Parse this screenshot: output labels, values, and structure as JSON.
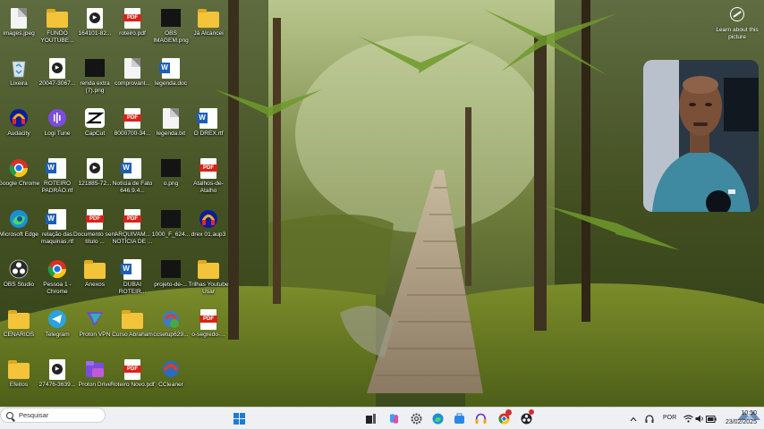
{
  "desktop": {
    "icons": [
      {
        "label": "images.jpeg",
        "icon": "blank-file-icon"
      },
      {
        "label": "FUNDO YOUTUBE...",
        "icon": "folder-icon"
      },
      {
        "label": "164101-82...",
        "icon": "video-file-icon"
      },
      {
        "label": "roteiro.pdf",
        "icon": "pdf-icon"
      },
      {
        "label": "OBS IMAGEM.png",
        "icon": "image-file-icon"
      },
      {
        "label": "Já Alcancei",
        "icon": "folder-icon"
      },
      {
        "label": "Lixeira",
        "icon": "recycle-bin-icon"
      },
      {
        "label": "20047-3067...",
        "icon": "video-file-icon"
      },
      {
        "label": "renda extra (7).png",
        "icon": "image-file-icon"
      },
      {
        "label": "comprovant...",
        "icon": "text-file-icon"
      },
      {
        "label": "legenda.doc",
        "icon": "word-doc-icon"
      },
      {
        "label": "Audacity",
        "icon": "audacity-icon"
      },
      {
        "label": "Logi Tune",
        "icon": "logi-tune-icon"
      },
      {
        "label": "CapCut",
        "icon": "capcut-icon"
      },
      {
        "label": "8000700-34...",
        "icon": "pdf-icon"
      },
      {
        "label": "legenda.txt",
        "icon": "text-file-icon"
      },
      {
        "label": "O DREX.rtf",
        "icon": "word-doc-icon"
      },
      {
        "label": "Google Chrome",
        "icon": "chrome-icon"
      },
      {
        "label": "ROTEIRO PADRÃO.rtf",
        "icon": "word-doc-icon"
      },
      {
        "label": "121885-72...",
        "icon": "video-file-icon"
      },
      {
        "label": "Notícia de Fato 646.9.4...",
        "icon": "word-doc-icon"
      },
      {
        "label": "o.png",
        "icon": "image-file-icon"
      },
      {
        "label": "Atalhos-de-Atalho",
        "icon": "pdf-icon"
      },
      {
        "label": "Microsoft Edge",
        "icon": "edge-icon"
      },
      {
        "label": "relação das maquinas.rtf",
        "icon": "word-doc-icon"
      },
      {
        "label": "Documento sem título ...",
        "icon": "pdf-icon"
      },
      {
        "label": "ARQUIVAM... NOTÍCIA DE ...",
        "icon": "pdf-icon"
      },
      {
        "label": "1000_F_624...",
        "icon": "image-file-icon"
      },
      {
        "label": "drex 01.aup3",
        "icon": "audacity-icon"
      },
      {
        "label": "OBS Studio",
        "icon": "obs-icon"
      },
      {
        "label": "Pessoa 1 - Chrome",
        "icon": "chrome-icon"
      },
      {
        "label": "Anexos",
        "icon": "folder-icon"
      },
      {
        "label": "DUBAI ROTEIR...",
        "icon": "word-doc-icon"
      },
      {
        "label": "projeto-de-...",
        "icon": "image-file-icon"
      },
      {
        "label": "Trilhas Youtube Usar",
        "icon": "folder-icon"
      },
      {
        "label": "CENÁRIOS",
        "icon": "folder-icon"
      },
      {
        "label": "Telegram",
        "icon": "telegram-icon"
      },
      {
        "label": "Proton VPN",
        "icon": "proton-vpn-icon"
      },
      {
        "label": "Curso Abraham",
        "icon": "folder-icon"
      },
      {
        "label": "ccsetup629...",
        "icon": "ccleaner-setup-icon"
      },
      {
        "label": "o-segredo-...",
        "icon": "pdf-icon"
      },
      {
        "label": "Efeitos",
        "icon": "folder-icon"
      },
      {
        "label": "27476-3639...",
        "icon": "video-file-icon"
      },
      {
        "label": "Proton Drive",
        "icon": "proton-drive-icon"
      },
      {
        "label": "Roteiro Novo.pdf",
        "icon": "pdf-icon"
      },
      {
        "label": "CCleaner",
        "icon": "ccleaner-icon"
      }
    ]
  },
  "widget": {
    "label": "Learn about this picture"
  },
  "taskbar": {
    "search_placeholder": "Pesquisar",
    "pinned": [
      "file-explorer-icon",
      "copilot-icon",
      "settings-icon",
      "edge-icon",
      "store-icon",
      "headphones-icon",
      "chrome-icon",
      "obs-icon"
    ],
    "language": "POR",
    "time": "10:50",
    "date": "23/02/2025"
  }
}
